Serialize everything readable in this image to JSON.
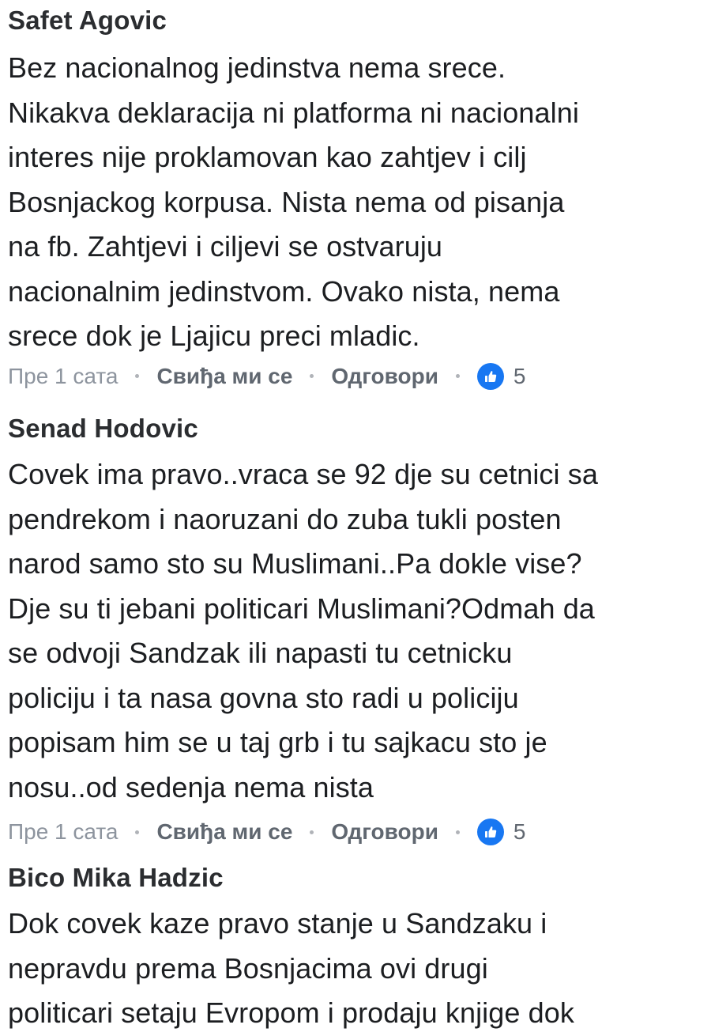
{
  "comments": [
    {
      "author": "Safet Agovic",
      "lines": [
        "Bez nacionalnog jedinstva nema srece.",
        "Nikakva deklaracija ni platforma ni nacionalni",
        "interes nije proklamovan kao zahtjev i cilj",
        "Bosnjackog korpusa. Nista nema od pisanja",
        "na fb. Zahtjevi i ciljevi se ostvaruju",
        "nacionalnim jedinstvom. Ovako nista, nema",
        "srece dok je Ljajicu preci mladic."
      ],
      "time": "Пре 1 сата",
      "like_label": "Свиђа ми се",
      "reply_label": "Одговори",
      "likes": "5",
      "reaction_icon": "thumbs-up-icon",
      "reaction_color": "#1877f2"
    },
    {
      "author": "Senad Hodovic",
      "lines": [
        "Covek ima pravo..vraca se 92 dje su cetnici sa",
        "pendrekom i naoruzani do zuba tukli posten",
        "narod samo sto su Muslimani..Pa  dokle vise?",
        "Dje su ti jebani politicari Muslimani?Odmah da",
        "se odvoji Sandzak ili napasti tu cetnicku",
        "policiju i ta nasa govna sto radi u policiju",
        "popisam him se u taj grb i tu sajkacu sto je",
        "nosu..od sedenja nema nista"
      ],
      "time": "Пре 1 сата",
      "like_label": "Свиђа ми се",
      "reply_label": "Одговори",
      "likes": "5",
      "reaction_icon": "thumbs-up-icon",
      "reaction_color": "#1877f2"
    },
    {
      "author": "Bico Mika Hadzic",
      "lines": [
        "Dok covek kaze pravo stanje u Sandzaku i",
        "nepravdu prema Bosnjacima ovi drugi",
        "politicari setaju Evropom i prodaju knjige  dok"
      ]
    }
  ]
}
